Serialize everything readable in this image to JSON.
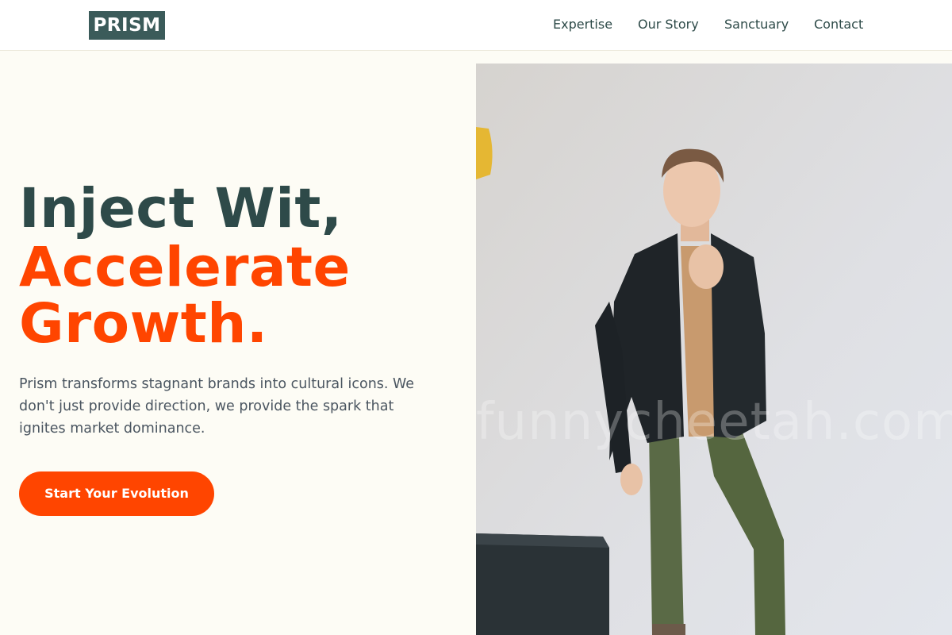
{
  "header": {
    "logo": "PRISM",
    "nav": [
      "Expertise",
      "Our Story",
      "Sanctuary",
      "Contact"
    ]
  },
  "hero": {
    "headline_line1": "Inject Wit,",
    "headline_line2": "Accelerate",
    "headline_line3": "Growth.",
    "description": "Prism transforms stagnant brands into cultural icons. We don't just provide direction, we provide the spark that ignites market dominance.",
    "cta_label": "Start Your Evolution"
  },
  "photo": {
    "watermark": "funnycheetah.com"
  },
  "colors": {
    "accent": "#ff4500",
    "brand_dark": "#2e4a49",
    "logo_bg": "#3b5b5a",
    "page_bg": "#fdfcf5"
  }
}
